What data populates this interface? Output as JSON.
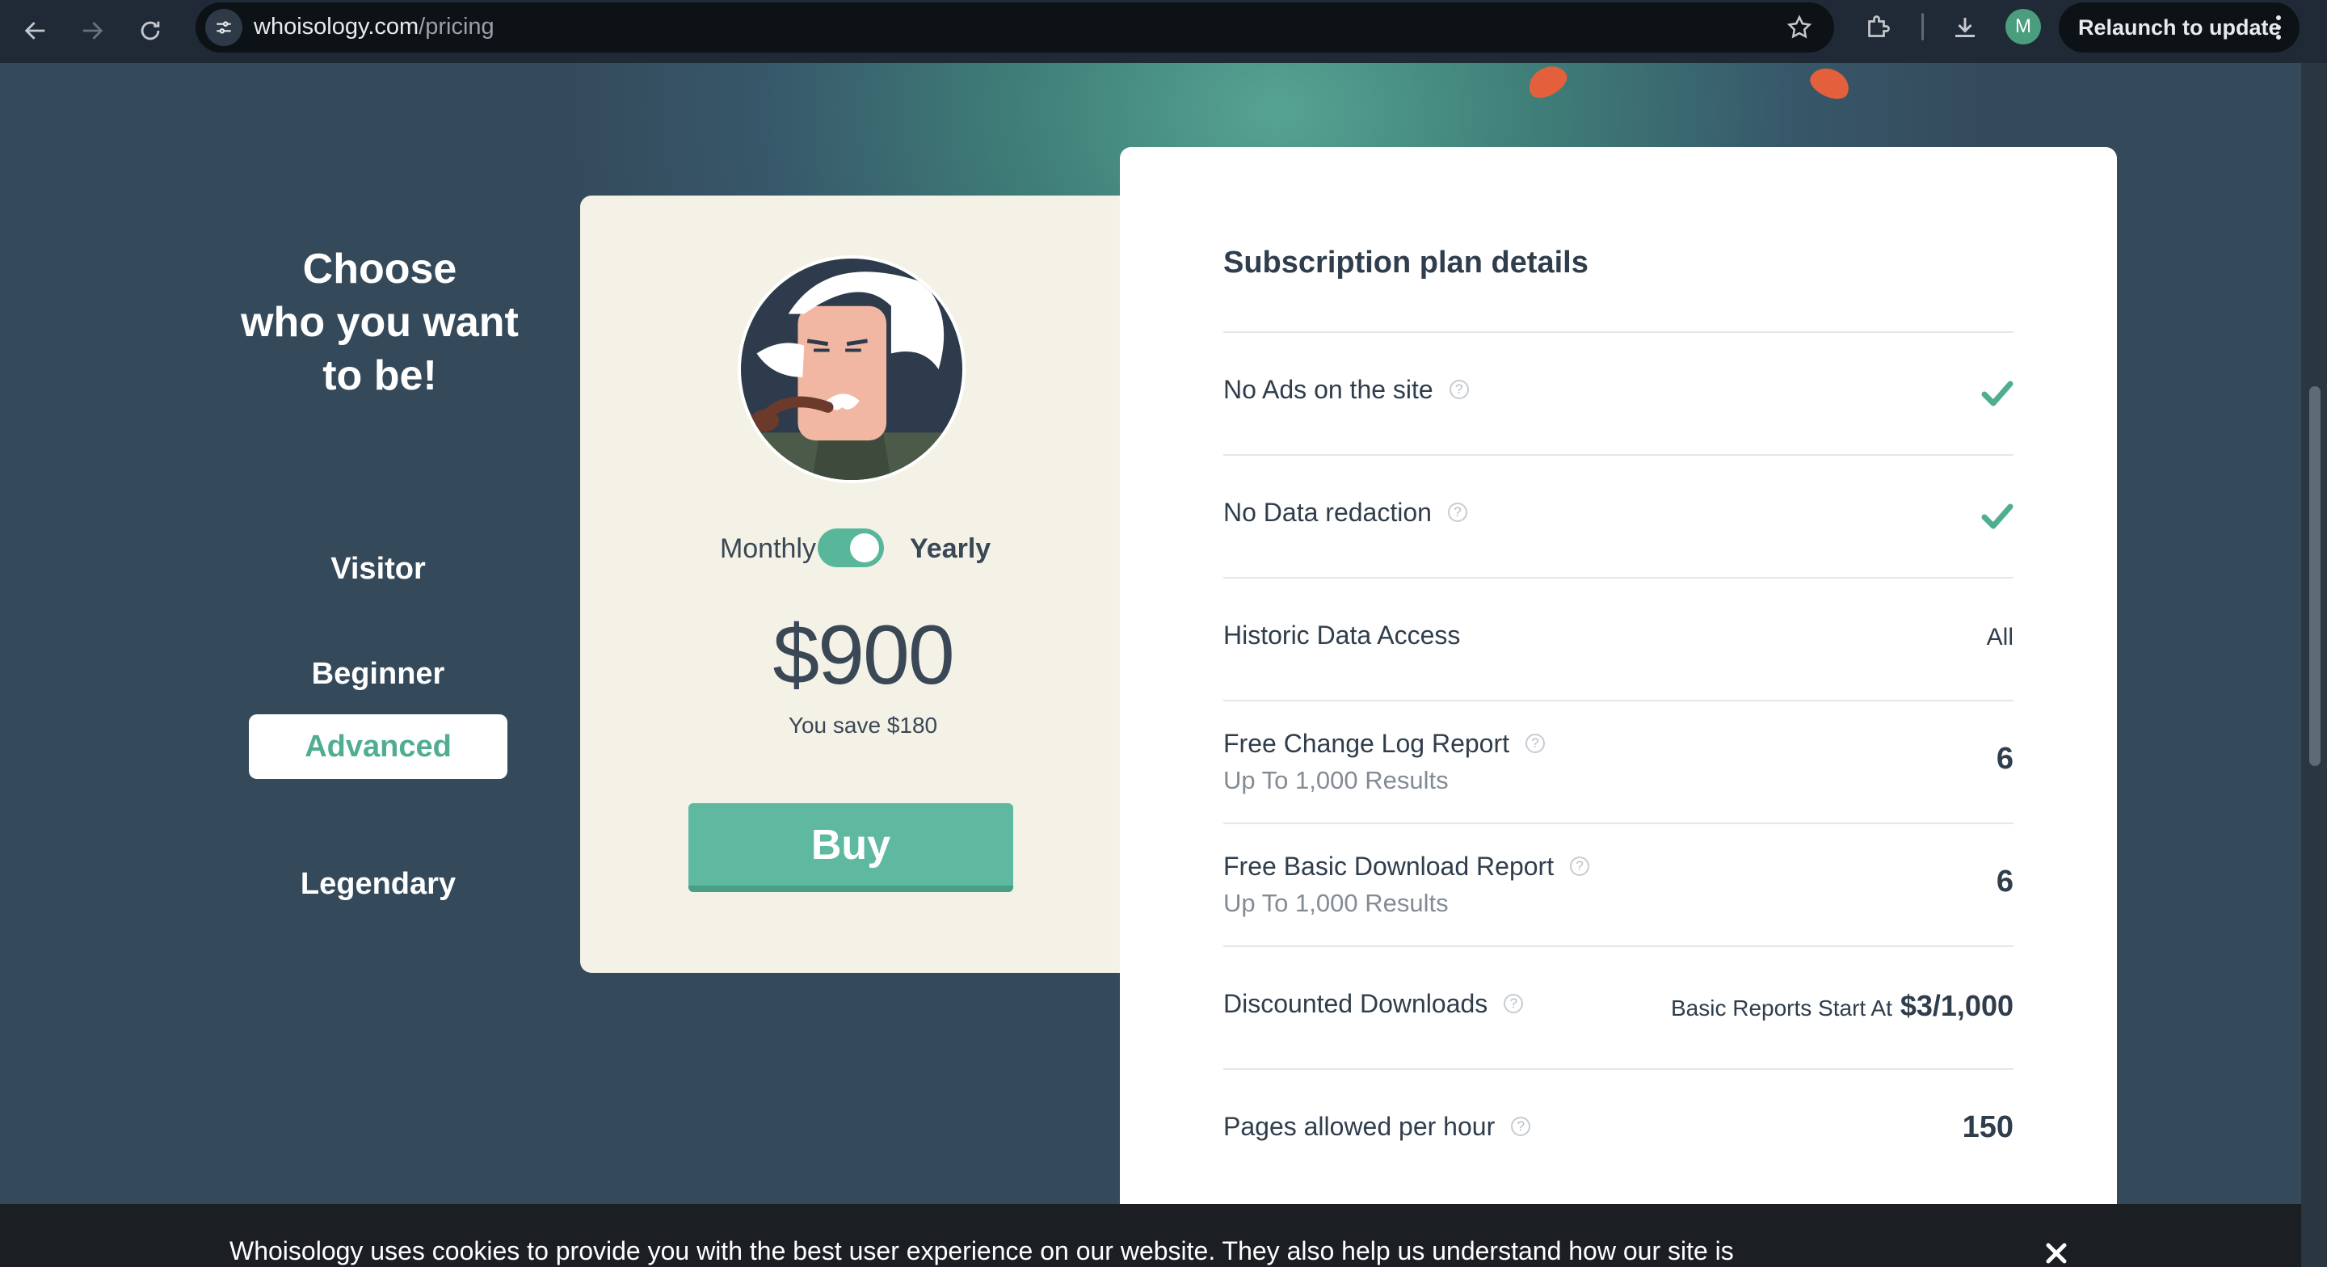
{
  "browser": {
    "url_domain": "whoisology.com",
    "url_path": "/pricing",
    "profile_initial": "M",
    "relaunch_label": "Relaunch to update"
  },
  "page": {
    "heading_line1": "Choose",
    "heading_line2": "who you want",
    "heading_line3": "to be!",
    "tiers": [
      {
        "label": "Visitor",
        "active": false
      },
      {
        "label": "Beginner",
        "active": false
      },
      {
        "label": "Advanced",
        "active": true
      },
      {
        "label": "Legendary",
        "active": false
      }
    ],
    "plan": {
      "billing_monthly": "Monthly",
      "billing_yearly": "Yearly",
      "billing_selected": "Yearly",
      "price": "$900",
      "savings": "You save $180",
      "buy_label": "Buy"
    },
    "details": {
      "title": "Subscription plan details",
      "rows": [
        {
          "label": "No Ads on the site",
          "value": "included"
        },
        {
          "label": "No Data redaction",
          "value": "included"
        },
        {
          "label": "Historic Data Access",
          "value": "All"
        },
        {
          "label": "Free Change Log Report",
          "sublabel": "Up To 1,000 Results",
          "value": "6"
        },
        {
          "label": "Free Basic Download Report",
          "sublabel": "Up To 1,000 Results",
          "value": "6"
        },
        {
          "label": "Discounted Downloads",
          "value_note": "Basic Reports Start At",
          "value": "$3/1,000"
        },
        {
          "label": "Pages allowed per hour",
          "value": "150"
        }
      ]
    },
    "cookie_text": "Whoisology uses cookies to provide you with the best user experience on our website. They also help us understand how our site is"
  },
  "colors": {
    "accent": "#5fb8a0",
    "active_tier_text": "#4fad92",
    "page_bg": "#34495a",
    "card_bg": "#f4f2e6",
    "leaf": "#e4603c"
  }
}
